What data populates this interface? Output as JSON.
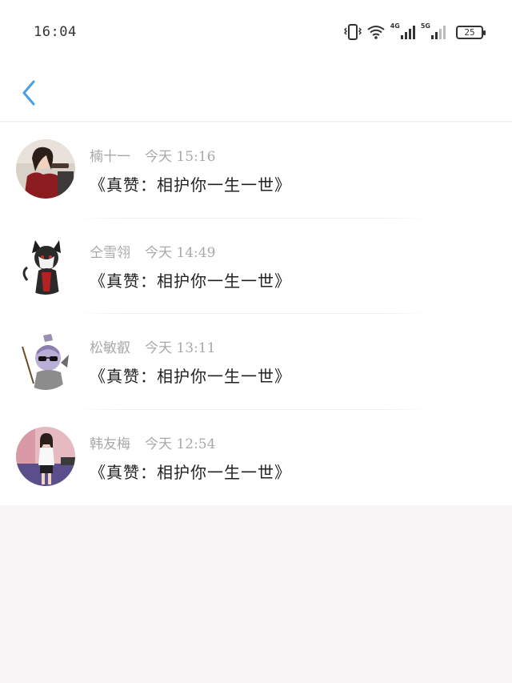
{
  "status_bar": {
    "time": "16:04",
    "network_1": "4G",
    "network_2": "5G",
    "battery": "25"
  },
  "nav": {
    "back_icon": "chevron-left-icon",
    "accent_color": "#4a9ee8"
  },
  "messages": [
    {
      "name": "楠十一",
      "time": "今天 15:16",
      "content": "《真赞：相护你一生一世》",
      "avatar_icon": "avatar-photo-girl"
    },
    {
      "name": "仝雪翎",
      "time": "今天 14:49",
      "content": "《真赞：相护你一生一世》",
      "avatar_icon": "avatar-cartoon-cat"
    },
    {
      "name": "松敏叡",
      "time": "今天 13:11",
      "content": "《真赞：相护你一生一世》",
      "avatar_icon": "avatar-cartoon-sunglasses"
    },
    {
      "name": "韩友梅",
      "time": "今天 12:54",
      "content": "《真赞：相护你一生一世》",
      "avatar_icon": "avatar-photo-room"
    }
  ]
}
